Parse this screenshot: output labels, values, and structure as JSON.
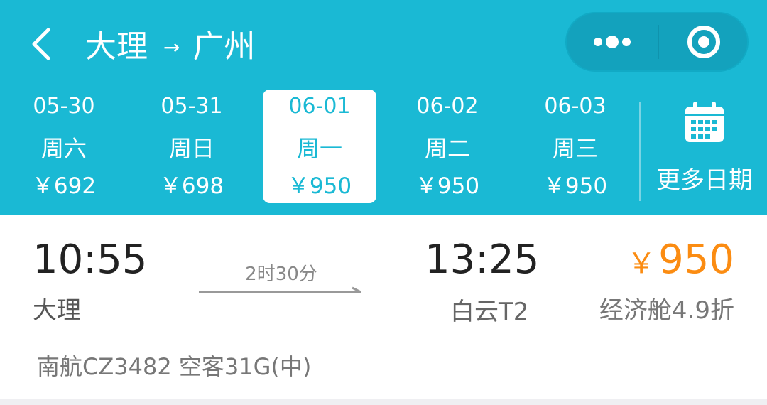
{
  "header": {
    "from": "大理",
    "arrow": "→",
    "to": "广州"
  },
  "dates": [
    {
      "date": "05-30",
      "weekday": "周六",
      "price": "￥692",
      "selected": false
    },
    {
      "date": "05-31",
      "weekday": "周日",
      "price": "￥698",
      "selected": false
    },
    {
      "date": "06-01",
      "weekday": "周一",
      "price": "￥950",
      "selected": true
    },
    {
      "date": "06-02",
      "weekday": "周二",
      "price": "￥950",
      "selected": false
    },
    {
      "date": "06-03",
      "weekday": "周三",
      "price": "￥950",
      "selected": false
    }
  ],
  "more_dates_label": "更多日期",
  "flight": {
    "dep_time": "10:55",
    "dep_city": "大理",
    "duration": "2时30分",
    "arr_time": "13:25",
    "arr_airport": "白云T2",
    "currency": "￥",
    "price": "950",
    "cabin": "经济舱4.9折",
    "info": "南航CZ3482 空客31G(中)"
  },
  "icons": {
    "back": "chevron-left-icon",
    "more": "more-dots-icon",
    "close": "target-circle-icon",
    "calendar": "calendar-icon"
  },
  "colors": {
    "brand": "#1ab9d4",
    "price": "#fb8c12",
    "capsule": "#13a2bd"
  }
}
